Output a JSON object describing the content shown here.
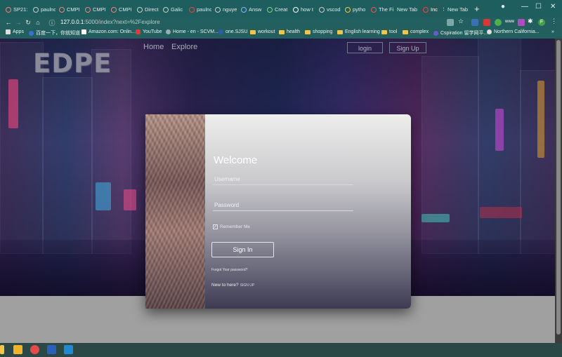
{
  "browser": {
    "tabs": [
      {
        "label": "SP21:",
        "active": false
      },
      {
        "label": "paulnc",
        "active": false
      },
      {
        "label": "CMPI",
        "active": false
      },
      {
        "label": "CMPI",
        "active": false
      },
      {
        "label": "CMPI",
        "active": false
      },
      {
        "label": "Direct",
        "active": false
      },
      {
        "label": "Galic",
        "active": false
      },
      {
        "label": "paulnc",
        "active": false
      },
      {
        "label": "nguye",
        "active": false
      },
      {
        "label": "Answ",
        "active": false
      },
      {
        "label": "Creat",
        "active": false
      },
      {
        "label": "how t",
        "active": false
      },
      {
        "label": "vscod",
        "active": false
      },
      {
        "label": "pytho",
        "active": false
      },
      {
        "label": "The Fi",
        "active": false
      },
      {
        "label": "New Tab",
        "active": false
      },
      {
        "label": "Inc",
        "active": true
      },
      {
        "label": "New Tab",
        "active": false
      }
    ],
    "address": {
      "host": "127.0.0.1",
      "path": ":5000/index?next=%2Fexplore"
    },
    "bookmarks": [
      {
        "label": "Apps",
        "icon": "apps-grid-icon"
      },
      {
        "label": "百度一下，你就知道",
        "icon": "folder-icon"
      },
      {
        "label": "Amazon.com: Onlin...",
        "icon": "amazon-icon"
      },
      {
        "label": "YouTube",
        "icon": "youtube-icon"
      },
      {
        "label": "Home - en - SCVM...",
        "icon": "site-icon"
      },
      {
        "label": "one.SJSU",
        "icon": "site-icon"
      },
      {
        "label": "workout",
        "icon": "folder-icon"
      },
      {
        "label": "health",
        "icon": "folder-icon"
      },
      {
        "label": "shopping",
        "icon": "folder-icon"
      },
      {
        "label": "English learning",
        "icon": "folder-icon"
      },
      {
        "label": "tool",
        "icon": "folder-icon"
      },
      {
        "label": "complex",
        "icon": "folder-icon"
      },
      {
        "label": "Cspiration 留学网平...",
        "icon": "site-icon"
      },
      {
        "label": "Northern California...",
        "icon": "site-icon"
      }
    ],
    "profile_initial": "F",
    "ext_badge": "www"
  },
  "site": {
    "logo": "EDPE",
    "nav": {
      "home": "Home",
      "explore": "Explore"
    },
    "auth": {
      "login": "login",
      "signup": "Sign Up"
    },
    "card": {
      "welcome": "Welcome",
      "username_placeholder": "Username",
      "password_placeholder": "Password",
      "remember": "Remember Me",
      "sign_in": "Sign In",
      "forgot": "Forgot Your password?",
      "new_here": "New to here?",
      "signup_link": "SIGN UP"
    }
  },
  "colors": {
    "tab_strip": "#1f5e5e",
    "taskbar": "#2b4746",
    "form_bottom": "#3d3a52"
  }
}
